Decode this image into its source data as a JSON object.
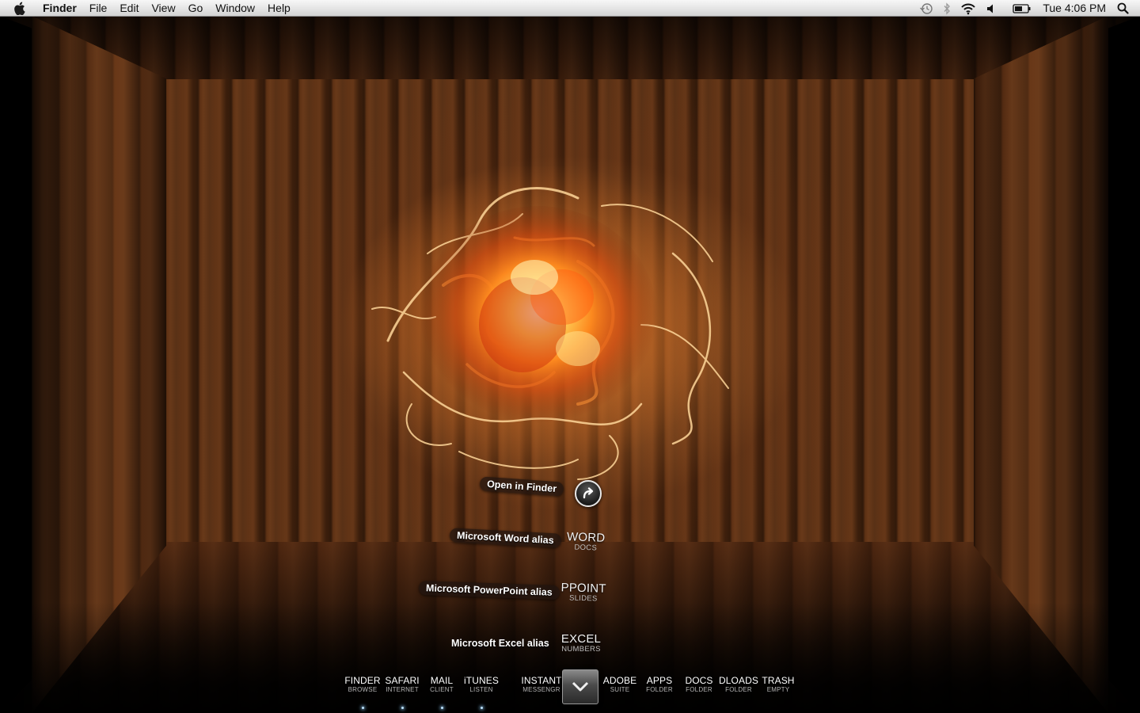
{
  "menubar": {
    "app_name": "Finder",
    "menus": [
      "File",
      "Edit",
      "View",
      "Go",
      "Window",
      "Help"
    ],
    "status_icons": [
      "time-machine-icon",
      "bluetooth-icon",
      "wifi-icon",
      "volume-icon",
      "battery-icon"
    ],
    "clock": "Tue 4:06 PM",
    "spotlight_icon": "spotlight-search-icon"
  },
  "stack": {
    "open_label": "Open in Finder",
    "open_icon": "open-arrow-icon",
    "items": [
      {
        "label": "Microsoft Word alias",
        "title": "WORD",
        "subtitle": "DOCS"
      },
      {
        "label": "Microsoft PowerPoint alias",
        "title": "PPOINT",
        "subtitle": "SLIDES"
      },
      {
        "label": "Microsoft Excel alias",
        "title": "EXCEL",
        "subtitle": "NUMBERS"
      }
    ]
  },
  "dock": {
    "items": [
      {
        "title": "FINDER",
        "subtitle": "BROWSE",
        "running": true
      },
      {
        "title": "SAFARI",
        "subtitle": "INTERNET",
        "running": true
      },
      {
        "title": "MAIL",
        "subtitle": "CLIENT",
        "running": true
      },
      {
        "title": "iTUNES",
        "subtitle": "LISTEN",
        "running": true
      },
      {
        "title": "INSTANT",
        "subtitle": "MESSENGR",
        "running": false
      },
      {
        "title": "ADOBE",
        "subtitle": "SUITE",
        "running": false
      },
      {
        "title": "APPS",
        "subtitle": "FOLDER",
        "running": false
      },
      {
        "title": "DOCS",
        "subtitle": "FOLDER",
        "running": false
      },
      {
        "title": "DLOADS",
        "subtitle": "FOLDER",
        "running": false
      },
      {
        "title": "TRASH",
        "subtitle": "EMPTY",
        "running": false
      }
    ],
    "stack_tile_icon": "chevron-down-icon"
  }
}
